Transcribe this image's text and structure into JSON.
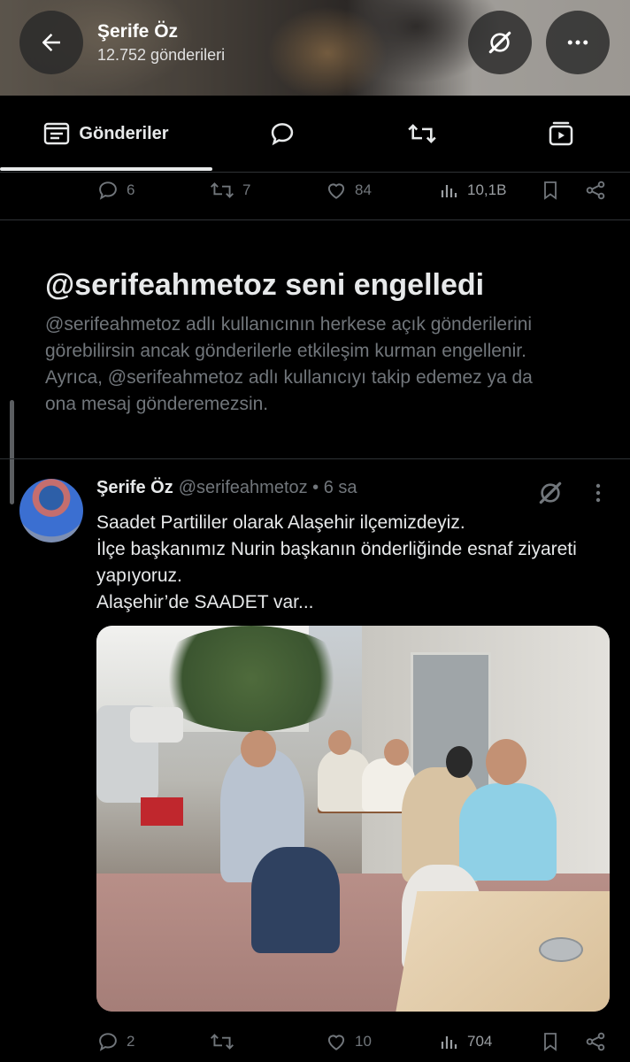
{
  "header": {
    "name": "Şerife Öz",
    "post_count": "12.752 gönderileri"
  },
  "tabs": [
    {
      "label": "Gönderiler",
      "icon": "posts-icon",
      "active": true
    },
    {
      "label": "",
      "icon": "replies-icon",
      "active": false
    },
    {
      "label": "",
      "icon": "retweet-icon",
      "active": false
    },
    {
      "label": "",
      "icon": "media-icon",
      "active": false
    }
  ],
  "prev_actions": {
    "replies": "6",
    "reposts": "7",
    "likes": "84",
    "views": "10,1B"
  },
  "blocked": {
    "title": "@serifeahmetoz seni engelledi",
    "body": "@serifeahmetoz adlı kullanıcının herkese açık gönderilerini görebilirsin ancak gönderilerle etkileşim kurman engellenir. Ayrıca, @serifeahmetoz adlı kullanıcıyı takip edemez ya da ona mesaj gönderemezsin.",
    "body_lines": [
      "@serifeahmetoz adlı kullanıcının herkese açık gönderilerini",
      "görebilirsin ancak gönderilerle etkileşim kurman engellenir.",
      "Ayrıca, @serifeahmetoz adlı kullanıcıyı takip edemez ya da",
      "ona mesaj gönderemezsin."
    ]
  },
  "tweet": {
    "name": "Şerife Öz",
    "handle_time": "@serifeahmetoz • 6 sa",
    "lines": [
      "Saadet Partililer olarak Alaşehir ilçemizdeyiz.",
      "İlçe başkanımız Nurin başkanın önderliğinde esnaf ziyareti",
      "yapıyoruz.",
      "Alaşehir’de SAADET var..."
    ],
    "actions": {
      "replies": "2",
      "reposts": "",
      "likes": "10",
      "views": "704"
    }
  },
  "colors": {
    "background": "#000000",
    "text": "#e7e9ea",
    "muted": "#71767b",
    "divider": "#2f3336"
  }
}
